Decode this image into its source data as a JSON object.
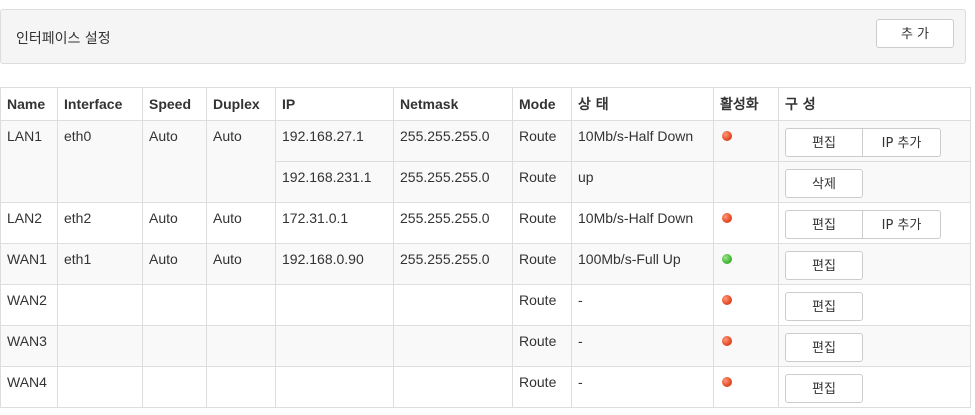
{
  "panel": {
    "title": "인터페이스 설정",
    "add_button": "추 가"
  },
  "table": {
    "headers": [
      "Name",
      "Interface",
      "Speed",
      "Duplex",
      "IP",
      "Netmask",
      "Mode",
      "상 태",
      "활성화",
      "구 성"
    ],
    "rows": [
      {
        "name": "LAN1",
        "interface": "eth0",
        "speed": "Auto",
        "duplex": "Auto",
        "ip": "192.168.27.1",
        "netmask": "255.255.255.0",
        "mode": "Route",
        "status": "10Mb/s-Half Down",
        "active": "down",
        "edit": "편집",
        "add_ip": "IP 추가"
      },
      {
        "ip": "192.168.231.1",
        "netmask": "255.255.255.0",
        "mode": "Route",
        "status": "up",
        "delete": "삭제"
      },
      {
        "name": "LAN2",
        "interface": "eth2",
        "speed": "Auto",
        "duplex": "Auto",
        "ip": "172.31.0.1",
        "netmask": "255.255.255.0",
        "mode": "Route",
        "status": "10Mb/s-Half Down",
        "active": "down",
        "edit": "편집",
        "add_ip": "IP 추가"
      },
      {
        "name": "WAN1",
        "interface": "eth1",
        "speed": "Auto",
        "duplex": "Auto",
        "ip": "192.168.0.90",
        "netmask": "255.255.255.0",
        "mode": "Route",
        "status": "100Mb/s-Full Up",
        "active": "up",
        "edit": "편집"
      },
      {
        "name": "WAN2",
        "mode": "Route",
        "status": "-",
        "active": "down",
        "edit": "편집"
      },
      {
        "name": "WAN3",
        "mode": "Route",
        "status": "-",
        "active": "down",
        "edit": "편집"
      },
      {
        "name": "WAN4",
        "mode": "Route",
        "status": "-",
        "active": "down",
        "edit": "편집"
      }
    ]
  },
  "colors": {
    "status_up": "#4cbb3a",
    "status_down": "#e8502c",
    "border": "#dddddd",
    "header_bg": "#f5f5f5"
  }
}
